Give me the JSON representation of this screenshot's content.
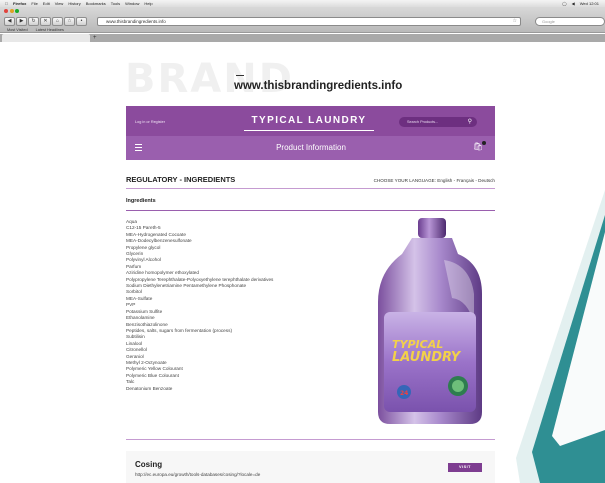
{
  "os_menubar": {
    "app": "Firefox",
    "menus": [
      "File",
      "Edit",
      "View",
      "History",
      "Bookmarks",
      "Tools",
      "Window",
      "Help"
    ],
    "clock": "Wed 12:01"
  },
  "browser": {
    "url": "www.thisbrandingredients.info",
    "search_placeholder": "Google",
    "bookmarks": [
      "Most Visited",
      "Latest Headlines"
    ],
    "new_tab_label": "+"
  },
  "site": {
    "brand_ghost": "BRAND",
    "url_heading": "www.thisbrandingredients.info",
    "login_label": "Log in  or  Register",
    "shop_title": "TYPICAL LAUNDRY",
    "search_placeholder": "Search Products...",
    "section_title": "Product Information"
  },
  "page": {
    "title": "REGULATORY - INGREDIENTS",
    "language_label": "CHOOSE YOUR LANGUAGE: English - Français - Deutsch",
    "ingredients_heading": "Ingredients",
    "ingredients": [
      "Aqua",
      "C12-15 Pareth-5",
      "MEA-Hydrogenated Cocoate",
      "MEA-Dodecylbenzenesulfonate",
      "Propylene glycol",
      "Glycerin",
      "Polyvinyl Alcohol",
      "Parfum",
      "Aziridine homopolymer ethoxylated",
      "Polypropylene Terephthalate-Polyoxyethylene terephthalate derivatives",
      "Sodium Diethylenetriamine Pentamethylene Phosphonate",
      "Sorbitol",
      "MEA-Sulfate",
      "PVP",
      "Potassium Sulfite",
      "Ethanolamine",
      "Benzisothiazolinone",
      "Peptides, salts, sugars from fermentation (process)",
      "Subtilisin",
      "Linalool",
      "Citronellol",
      "Geraniol",
      "Methyl 2-Octynoate",
      "Polymeric Yellow Colourant",
      "Polymeric Blue Colourant",
      "Talc",
      "Denatonium Benzoate"
    ],
    "bottle_label_line1": "TYPICAL",
    "bottle_label_line2": "LAUNDRY",
    "bottle_badge": "24",
    "cosing_title": "Cosing",
    "cosing_url": "http://ec.europa.eu/growth/tools-databases/cosing/?locale=de",
    "visit_label": "VISIT"
  },
  "colors": {
    "purple_dark": "#8b4b9d",
    "purple_light": "#9a5fae",
    "teal_decor": "#2f8f93"
  }
}
